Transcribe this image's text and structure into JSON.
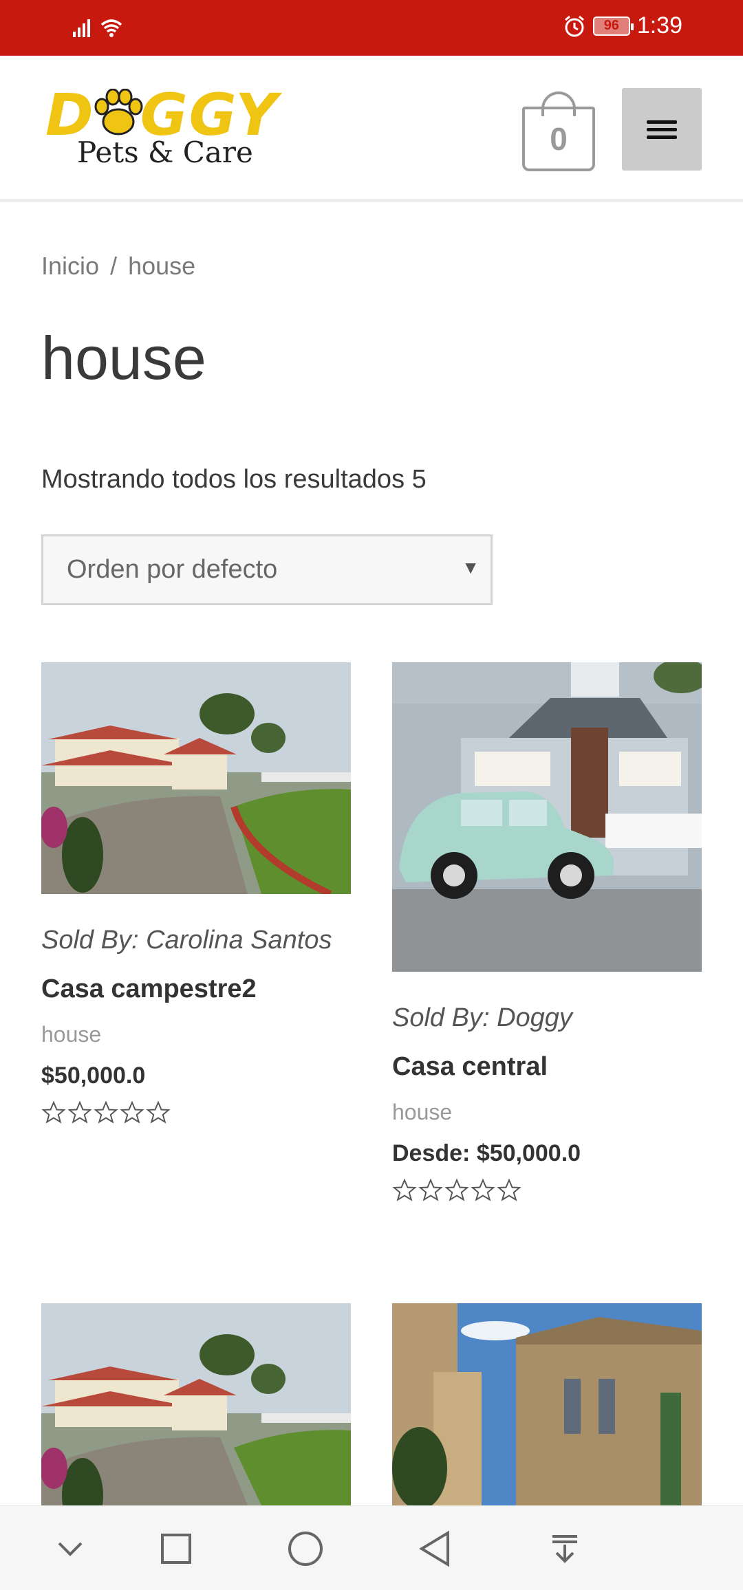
{
  "status_bar": {
    "time": "1:39",
    "battery": "96",
    "bg_color": "#c8190e"
  },
  "header": {
    "logo": {
      "word": "DOGGY",
      "tagline": "Pets & Care",
      "brand_color": "#f0c412"
    },
    "cart_count": "0",
    "menu_icon": "hamburger-icon"
  },
  "breadcrumb": {
    "home": "Inicio",
    "separator": "/",
    "current": "house"
  },
  "page_title": "house",
  "result_count": "Mostrando todos los resultados 5",
  "orderby": {
    "selected": "Orden por defecto"
  },
  "products": [
    {
      "sold_by": "Sold By: Carolina Santos",
      "name": "Casa campestre2",
      "category": "house",
      "price": "$50,000.0",
      "rating": 0,
      "image": "country-house-photo"
    },
    {
      "sold_by": "Sold By: Doggy",
      "name": "Casa central",
      "category": "house",
      "price": "Desde: $50,000.0",
      "rating": 0,
      "image": "house-with-car-photo"
    },
    {
      "image": "country-house-photo"
    },
    {
      "image": "old-town-street-photo"
    }
  ],
  "nav_bar": {
    "icons": [
      "chevron-down-icon",
      "square-recents-icon",
      "circle-home-icon",
      "triangle-back-icon",
      "download-icon"
    ]
  }
}
